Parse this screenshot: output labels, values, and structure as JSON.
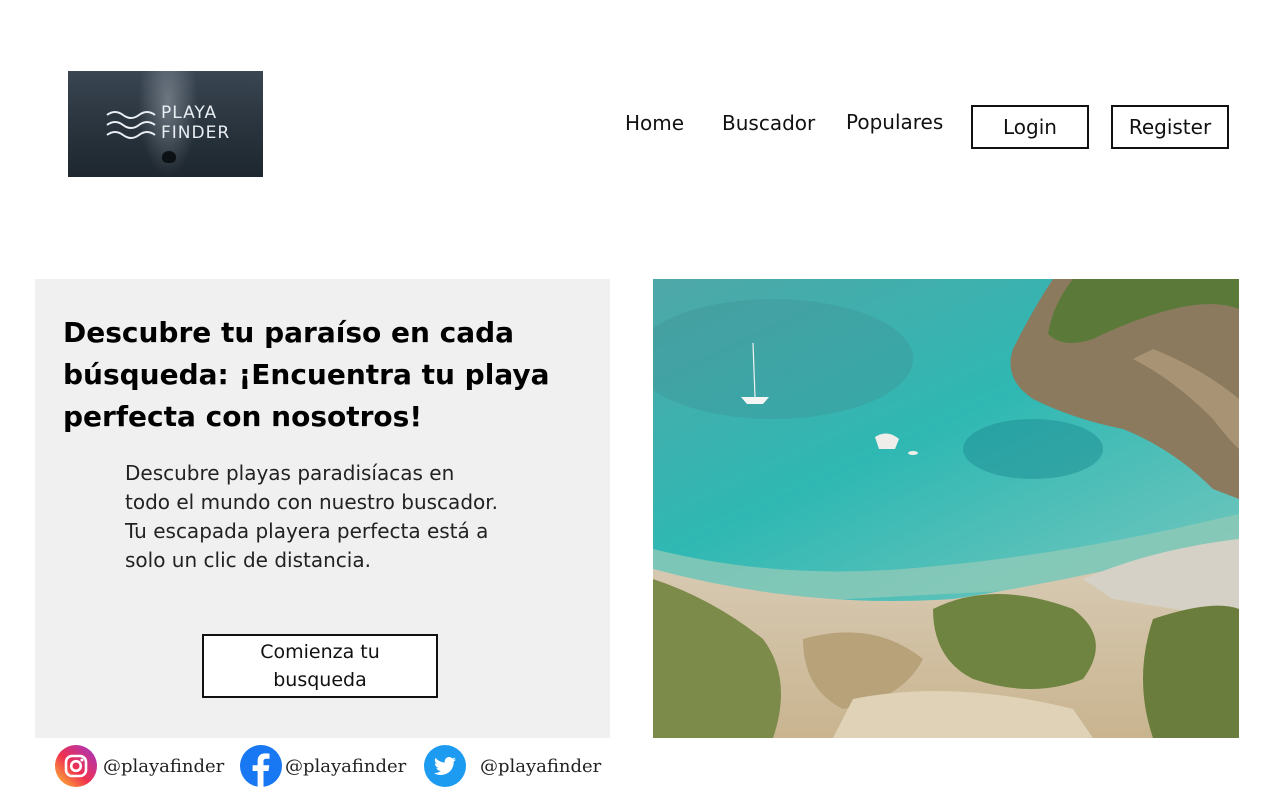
{
  "logo": {
    "line1": "PLAYA",
    "line2": "FINDER"
  },
  "nav": {
    "home": "Home",
    "search": "Buscador",
    "popular": "Populares",
    "login": "Login",
    "register": "Register"
  },
  "hero": {
    "title": "Descubre tu paraíso en cada búsqueda: ¡Encuentra tu playa perfecta con nosotros!",
    "description": "Descubre playas paradisíacas en todo el mundo con nuestro buscador. Tu escapada playera perfecta está a solo un clic de distancia.",
    "cta": "Comienza tu busqueda"
  },
  "social": [
    {
      "network": "instagram",
      "icon": "instagram-icon",
      "handle": "@playafinder"
    },
    {
      "network": "facebook",
      "icon": "facebook-icon",
      "handle": "@playafinder"
    },
    {
      "network": "twitter",
      "icon": "twitter-icon",
      "handle": "@playafinder"
    }
  ],
  "colors": {
    "panel": "#f0f0f0",
    "facebook": "#1877f2",
    "twitter": "#1d9bf0",
    "sea": "#3fb3b0"
  }
}
